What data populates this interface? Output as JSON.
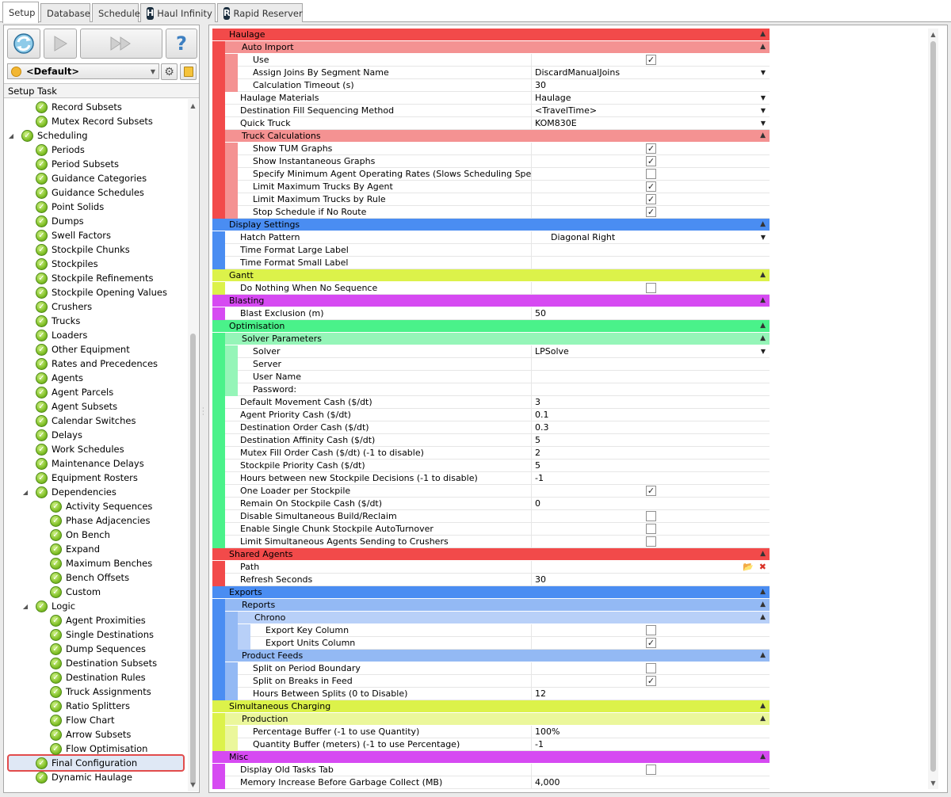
{
  "tabs": [
    {
      "label": "Setup",
      "active": true,
      "icon": ""
    },
    {
      "label": "Database",
      "active": false,
      "icon": ""
    },
    {
      "label": "Schedule",
      "active": false,
      "icon": ""
    },
    {
      "label": "Haul Infinity",
      "active": false,
      "icon": "haul-infinity-app-icon"
    },
    {
      "label": "Rapid Reserver",
      "active": false,
      "icon": "rapid-reserver-app-icon"
    }
  ],
  "toolbar": {
    "refresh_icon": "refresh-icon",
    "play_icon": "play-icon",
    "fast_forward_icon": "fast-forward-icon",
    "help_icon": "help-icon",
    "help_glyph": "?",
    "profile_value": "<Default>",
    "settings_icon": "gear-icon",
    "notebook_icon": "notebook-icon"
  },
  "tree": {
    "header": "Setup Task",
    "items": [
      {
        "label": "Record Subsets",
        "level": 2
      },
      {
        "label": "Mutex Record Subsets",
        "level": 2
      },
      {
        "label": "Scheduling",
        "level": 1,
        "expanded": true
      },
      {
        "label": "Periods",
        "level": 2
      },
      {
        "label": "Period Subsets",
        "level": 2
      },
      {
        "label": "Guidance Categories",
        "level": 2
      },
      {
        "label": "Guidance Schedules",
        "level": 2
      },
      {
        "label": "Point Solids",
        "level": 2
      },
      {
        "label": "Dumps",
        "level": 2
      },
      {
        "label": "Swell Factors",
        "level": 2
      },
      {
        "label": "Stockpile Chunks",
        "level": 2
      },
      {
        "label": "Stockpiles",
        "level": 2
      },
      {
        "label": "Stockpile Refinements",
        "level": 2
      },
      {
        "label": "Stockpile Opening Values",
        "level": 2
      },
      {
        "label": "Crushers",
        "level": 2
      },
      {
        "label": "Trucks",
        "level": 2
      },
      {
        "label": "Loaders",
        "level": 2
      },
      {
        "label": "Other Equipment",
        "level": 2
      },
      {
        "label": "Rates and Precedences",
        "level": 2
      },
      {
        "label": "Agents",
        "level": 2
      },
      {
        "label": "Agent Parcels",
        "level": 2
      },
      {
        "label": "Agent Subsets",
        "level": 2
      },
      {
        "label": "Calendar Switches",
        "level": 2
      },
      {
        "label": "Delays",
        "level": 2
      },
      {
        "label": "Work Schedules",
        "level": 2
      },
      {
        "label": "Maintenance Delays",
        "level": 2
      },
      {
        "label": "Equipment Rosters",
        "level": 2
      },
      {
        "label": "Dependencies",
        "level": 2,
        "expanded": true
      },
      {
        "label": "Activity Sequences",
        "level": 3
      },
      {
        "label": "Phase Adjacencies",
        "level": 3
      },
      {
        "label": "On Bench",
        "level": 3
      },
      {
        "label": "Expand",
        "level": 3
      },
      {
        "label": "Maximum Benches",
        "level": 3
      },
      {
        "label": "Bench Offsets",
        "level": 3
      },
      {
        "label": "Custom",
        "level": 3
      },
      {
        "label": "Logic",
        "level": 2,
        "expanded": true
      },
      {
        "label": "Agent Proximities",
        "level": 3
      },
      {
        "label": "Single Destinations",
        "level": 3
      },
      {
        "label": "Dump Sequences",
        "level": 3
      },
      {
        "label": "Destination Subsets",
        "level": 3
      },
      {
        "label": "Destination Rules",
        "level": 3
      },
      {
        "label": "Truck Assignments",
        "level": 3
      },
      {
        "label": "Ratio Splitters",
        "level": 3
      },
      {
        "label": "Flow Chart",
        "level": 3
      },
      {
        "label": "Arrow Subsets",
        "level": 3
      },
      {
        "label": "Flow Optimisation",
        "level": 3
      },
      {
        "label": "Final Configuration",
        "level": 2,
        "selected": true
      },
      {
        "label": "Dynamic Haulage",
        "level": 2
      }
    ]
  },
  "colors": {
    "haulage": "#f24a4a",
    "haulage_sub": "#f49292",
    "display": "#4a8df2",
    "gantt": "#dcf24a",
    "blasting": "#d64af2",
    "optimisation": "#4af28a",
    "optimisation_sub": "#95f5b8",
    "exports": "#4a8df2",
    "exports_sub": "#93b9f4",
    "exports_sub2": "#b8d0f8",
    "charging": "#dcf24a",
    "charging_sub": "#ebf79b",
    "misc": "#d64af2"
  },
  "property_grid": [
    {
      "type": "cat",
      "label": "Haulage",
      "color": "haulage"
    },
    {
      "type": "sub",
      "level": 1,
      "label": "Auto Import",
      "color": "haulage_sub",
      "bands": [
        "haulage"
      ]
    },
    {
      "type": "prop",
      "level": 2,
      "name": "Use",
      "checkbox": true,
      "checked": true,
      "bands": [
        "haulage",
        "haulage_sub"
      ]
    },
    {
      "type": "prop",
      "level": 2,
      "name": "Assign Joins By Segment Name",
      "value": "DiscardManualJoins",
      "dropdown": true,
      "bands": [
        "haulage",
        "haulage_sub"
      ]
    },
    {
      "type": "prop",
      "level": 2,
      "name": "Calculation Timeout (s)",
      "value": "30",
      "bands": [
        "haulage",
        "haulage_sub"
      ]
    },
    {
      "type": "prop",
      "level": 1,
      "name": "Haulage Materials",
      "value": "Haulage",
      "dropdown": true,
      "bands": [
        "haulage"
      ]
    },
    {
      "type": "prop",
      "level": 1,
      "name": "Destination Fill Sequencing Method",
      "value": "<TravelTime>",
      "dropdown": true,
      "bands": [
        "haulage"
      ]
    },
    {
      "type": "prop",
      "level": 1,
      "name": "Quick Truck",
      "value": "KOM830E",
      "dropdown": true,
      "bands": [
        "haulage"
      ]
    },
    {
      "type": "sub",
      "level": 1,
      "label": "Truck Calculations",
      "color": "haulage_sub",
      "bands": [
        "haulage"
      ]
    },
    {
      "type": "prop",
      "level": 2,
      "name": "Show TUM Graphs",
      "checkbox": true,
      "checked": true,
      "bands": [
        "haulage",
        "haulage_sub"
      ]
    },
    {
      "type": "prop",
      "level": 2,
      "name": "Show Instantaneous Graphs",
      "checkbox": true,
      "checked": true,
      "bands": [
        "haulage",
        "haulage_sub"
      ]
    },
    {
      "type": "prop",
      "level": 2,
      "name": "Specify Minimum Agent Operating Rates (Slows Scheduling Speed)",
      "checkbox": true,
      "checked": false,
      "bands": [
        "haulage",
        "haulage_sub"
      ]
    },
    {
      "type": "prop",
      "level": 2,
      "name": "Limit Maximum Trucks By Agent",
      "checkbox": true,
      "checked": true,
      "bands": [
        "haulage",
        "haulage_sub"
      ]
    },
    {
      "type": "prop",
      "level": 2,
      "name": "Limit Maximum Trucks by Rule",
      "checkbox": true,
      "checked": true,
      "bands": [
        "haulage",
        "haulage_sub"
      ]
    },
    {
      "type": "prop",
      "level": 2,
      "name": "Stop Schedule if No Route",
      "checkbox": true,
      "checked": true,
      "bands": [
        "haulage",
        "haulage_sub"
      ]
    },
    {
      "type": "cat",
      "label": "Display Settings",
      "color": "display"
    },
    {
      "type": "prop",
      "level": 1,
      "name": "Hatch Pattern",
      "value": "Diagonal Right",
      "dropdown": true,
      "indent_value": true,
      "bands": [
        "display"
      ]
    },
    {
      "type": "prop",
      "level": 1,
      "name": "Time Format Large Label",
      "value": "",
      "bands": [
        "display"
      ]
    },
    {
      "type": "prop",
      "level": 1,
      "name": "Time Format Small Label",
      "value": "",
      "bands": [
        "display"
      ]
    },
    {
      "type": "cat",
      "label": "Gantt",
      "color": "gantt"
    },
    {
      "type": "prop",
      "level": 1,
      "name": "Do Nothing When No Sequence",
      "checkbox": true,
      "checked": false,
      "bands": [
        "gantt"
      ]
    },
    {
      "type": "cat",
      "label": "Blasting",
      "color": "blasting"
    },
    {
      "type": "prop",
      "level": 1,
      "name": "Blast Exclusion (m)",
      "value": "50",
      "bands": [
        "blasting"
      ]
    },
    {
      "type": "cat",
      "label": "Optimisation",
      "color": "optimisation"
    },
    {
      "type": "sub",
      "level": 1,
      "label": "Solver Parameters",
      "color": "optimisation_sub",
      "bands": [
        "optimisation"
      ]
    },
    {
      "type": "prop",
      "level": 2,
      "name": "Solver",
      "value": "LPSolve",
      "dropdown": true,
      "bands": [
        "optimisation",
        "optimisation_sub"
      ]
    },
    {
      "type": "prop",
      "level": 2,
      "name": "Server",
      "value": "",
      "bands": [
        "optimisation",
        "optimisation_sub"
      ]
    },
    {
      "type": "prop",
      "level": 2,
      "name": "User Name",
      "value": "",
      "bands": [
        "optimisation",
        "optimisation_sub"
      ]
    },
    {
      "type": "prop",
      "level": 2,
      "name": "Password:",
      "value": "",
      "bands": [
        "optimisation",
        "optimisation_sub"
      ]
    },
    {
      "type": "prop",
      "level": 1,
      "name": "Default Movement Cash ($/dt)",
      "value": "3",
      "bands": [
        "optimisation"
      ]
    },
    {
      "type": "prop",
      "level": 1,
      "name": "Agent Priority Cash ($/dt)",
      "value": "0.1",
      "bands": [
        "optimisation"
      ]
    },
    {
      "type": "prop",
      "level": 1,
      "name": "Destination Order Cash ($/dt)",
      "value": "0.3",
      "bands": [
        "optimisation"
      ]
    },
    {
      "type": "prop",
      "level": 1,
      "name": "Destination Affinity Cash ($/dt)",
      "value": "5",
      "bands": [
        "optimisation"
      ]
    },
    {
      "type": "prop",
      "level": 1,
      "name": "Mutex Fill Order Cash ($/dt) (-1 to disable)",
      "value": "2",
      "bands": [
        "optimisation"
      ]
    },
    {
      "type": "prop",
      "level": 1,
      "name": "Stockpile Priority Cash ($/dt)",
      "value": "5",
      "bands": [
        "optimisation"
      ]
    },
    {
      "type": "prop",
      "level": 1,
      "name": "Hours between new Stockpile Decisions (-1 to disable)",
      "value": "-1",
      "bands": [
        "optimisation"
      ]
    },
    {
      "type": "prop",
      "level": 1,
      "name": "One Loader per Stockpile",
      "checkbox": true,
      "checked": true,
      "bands": [
        "optimisation"
      ]
    },
    {
      "type": "prop",
      "level": 1,
      "name": "Remain On Stockpile Cash ($/dt)",
      "value": "0",
      "bands": [
        "optimisation"
      ]
    },
    {
      "type": "prop",
      "level": 1,
      "name": "Disable Simultaneous Build/Reclaim",
      "checkbox": true,
      "checked": false,
      "bands": [
        "optimisation"
      ]
    },
    {
      "type": "prop",
      "level": 1,
      "name": "Enable Single Chunk Stockpile AutoTurnover",
      "checkbox": true,
      "checked": false,
      "bands": [
        "optimisation"
      ]
    },
    {
      "type": "prop",
      "level": 1,
      "name": "Limit Simultaneous Agents Sending to Crushers",
      "checkbox": true,
      "checked": false,
      "bands": [
        "optimisation"
      ]
    },
    {
      "type": "cat",
      "label": "Shared Agents",
      "color": "haulage"
    },
    {
      "type": "prop",
      "level": 1,
      "name": "Path",
      "value": "",
      "path_buttons": true,
      "bands": [
        "haulage"
      ]
    },
    {
      "type": "prop",
      "level": 1,
      "name": "Refresh Seconds",
      "value": "30",
      "bands": [
        "haulage"
      ]
    },
    {
      "type": "cat",
      "label": "Exports",
      "color": "exports"
    },
    {
      "type": "sub",
      "level": 1,
      "label": "Reports",
      "color": "exports_sub",
      "bands": [
        "exports"
      ]
    },
    {
      "type": "sub",
      "level": 2,
      "label": "Chrono",
      "color": "exports_sub2",
      "bands": [
        "exports",
        "exports_sub"
      ]
    },
    {
      "type": "prop",
      "level": 3,
      "name": "Export Key Column",
      "checkbox": true,
      "checked": false,
      "bands": [
        "exports",
        "exports_sub",
        "exports_sub2"
      ]
    },
    {
      "type": "prop",
      "level": 3,
      "name": "Export Units Column",
      "checkbox": true,
      "checked": true,
      "bands": [
        "exports",
        "exports_sub",
        "exports_sub2"
      ]
    },
    {
      "type": "sub",
      "level": 1,
      "label": "Product Feeds",
      "color": "exports_sub",
      "bands": [
        "exports"
      ]
    },
    {
      "type": "prop",
      "level": 2,
      "name": "Split on Period Boundary",
      "checkbox": true,
      "checked": false,
      "bands": [
        "exports",
        "exports_sub"
      ]
    },
    {
      "type": "prop",
      "level": 2,
      "name": "Split on Breaks in Feed",
      "checkbox": true,
      "checked": true,
      "bands": [
        "exports",
        "exports_sub"
      ]
    },
    {
      "type": "prop",
      "level": 2,
      "name": "Hours Between Splits (0 to Disable)",
      "value": "12",
      "bands": [
        "exports",
        "exports_sub"
      ]
    },
    {
      "type": "cat",
      "label": "Simultaneous Charging",
      "color": "charging"
    },
    {
      "type": "sub",
      "level": 1,
      "label": "Production",
      "color": "charging_sub",
      "bands": [
        "charging"
      ]
    },
    {
      "type": "prop",
      "level": 2,
      "name": "Percentage Buffer (-1 to use Quantity)",
      "value": "100%",
      "bands": [
        "charging",
        "charging_sub"
      ]
    },
    {
      "type": "prop",
      "level": 2,
      "name": "Quantity Buffer (meters) (-1 to use Percentage)",
      "value": "-1",
      "bands": [
        "charging",
        "charging_sub"
      ]
    },
    {
      "type": "cat",
      "label": "Misc",
      "color": "misc"
    },
    {
      "type": "prop",
      "level": 1,
      "name": "Display Old Tasks Tab",
      "checkbox": true,
      "checked": false,
      "bands": [
        "misc"
      ]
    },
    {
      "type": "prop",
      "level": 1,
      "name": "Memory Increase Before Garbage Collect (MB)",
      "value": "4,000",
      "bands": [
        "misc"
      ]
    }
  ]
}
